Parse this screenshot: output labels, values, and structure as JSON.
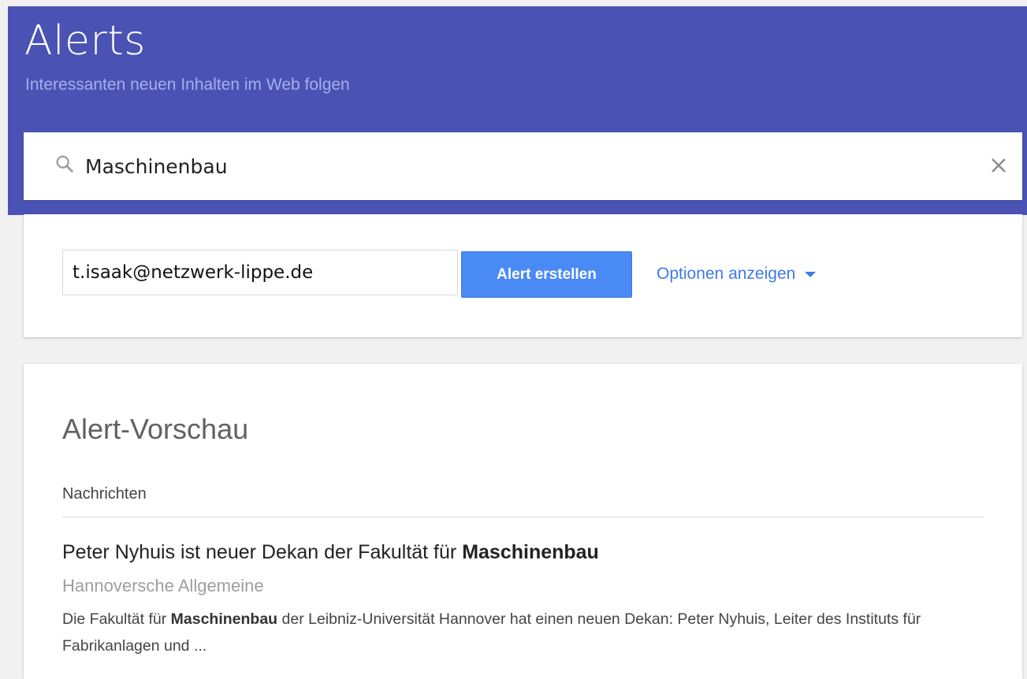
{
  "header": {
    "title": "Alerts",
    "subtitle": "Interessanten neuen Inhalten im Web folgen",
    "background": "#4a52b4"
  },
  "search": {
    "icon": "search-icon",
    "value": "Maschinenbau",
    "clear_icon": "close-icon"
  },
  "create": {
    "email_value": "t.isaak@netzwerk-lippe.de",
    "button_label": "Alert erstellen",
    "options_label": "Optionen anzeigen",
    "options_icon": "caret-down-icon",
    "accent": "#4a8af4"
  },
  "preview": {
    "title": "Alert-Vorschau",
    "section": "Nachrichten",
    "article": {
      "title_prefix": "Peter Nyhuis ist neuer Dekan der Fakultät für ",
      "title_highlight": "Maschinenbau",
      "source": "Hannoversche Allgemeine",
      "snippet_prefix": "Die Fakultät für ",
      "snippet_highlight": "Maschinenbau",
      "snippet_suffix": " der Leibniz-Universität Hannover hat einen neuen Dekan: Peter Nyhuis, Leiter des Instituts für Fabrikanlagen und ..."
    }
  }
}
